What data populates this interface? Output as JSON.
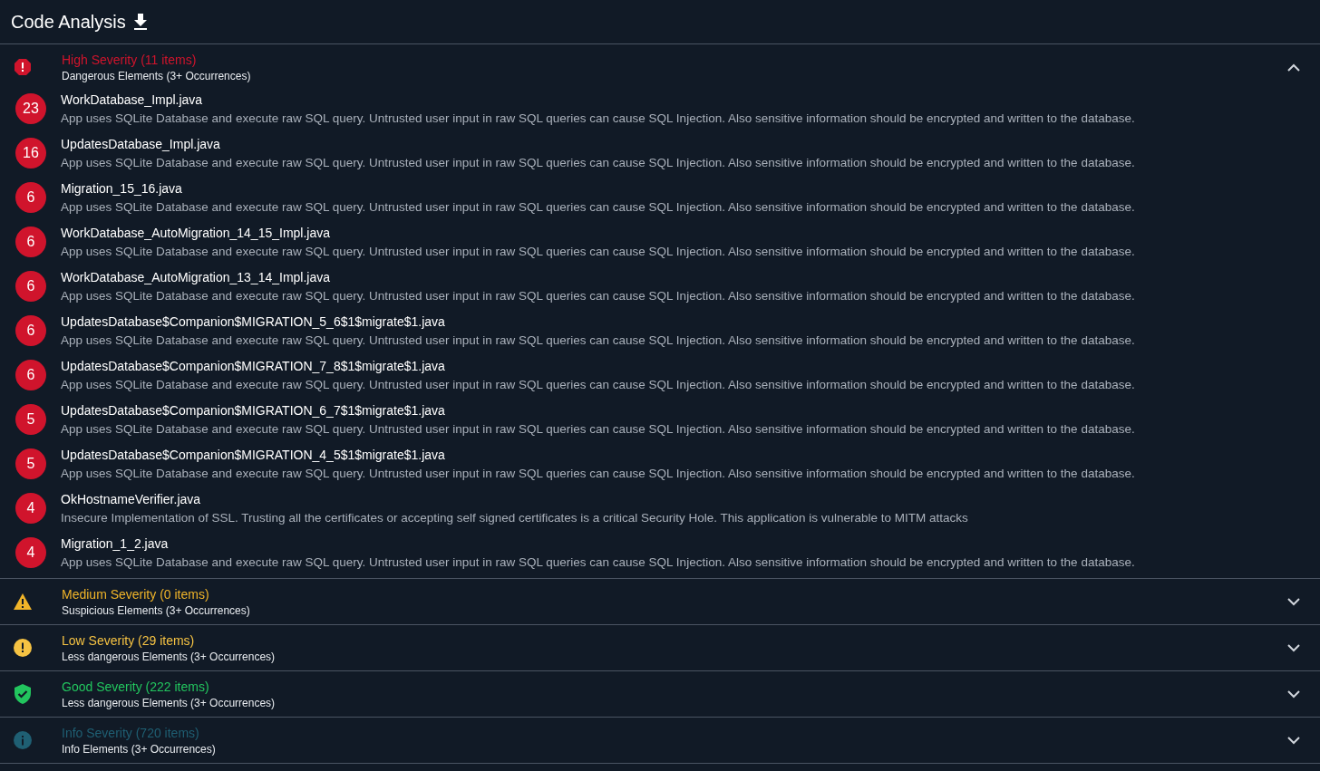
{
  "title": "Code Analysis",
  "sections": [
    {
      "kind": "error",
      "color": "#d0142c",
      "title": "High Severity (11 items)",
      "subtitle": "Dangerous Elements (3+ Occurrences)",
      "expanded": true,
      "items": [
        {
          "count": "23",
          "file": "WorkDatabase_Impl.java",
          "description": "App uses SQLite Database and execute raw SQL query. Untrusted user input in raw SQL queries can cause SQL Injection. Also sensitive information should be encrypted and written to the database."
        },
        {
          "count": "16",
          "file": "UpdatesDatabase_Impl.java",
          "description": "App uses SQLite Database and execute raw SQL query. Untrusted user input in raw SQL queries can cause SQL Injection. Also sensitive information should be encrypted and written to the database."
        },
        {
          "count": "6",
          "file": "Migration_15_16.java",
          "description": "App uses SQLite Database and execute raw SQL query. Untrusted user input in raw SQL queries can cause SQL Injection. Also sensitive information should be encrypted and written to the database."
        },
        {
          "count": "6",
          "file": "WorkDatabase_AutoMigration_14_15_Impl.java",
          "description": "App uses SQLite Database and execute raw SQL query. Untrusted user input in raw SQL queries can cause SQL Injection. Also sensitive information should be encrypted and written to the database."
        },
        {
          "count": "6",
          "file": "WorkDatabase_AutoMigration_13_14_Impl.java",
          "description": "App uses SQLite Database and execute raw SQL query. Untrusted user input in raw SQL queries can cause SQL Injection. Also sensitive information should be encrypted and written to the database."
        },
        {
          "count": "6",
          "file": "UpdatesDatabase$Companion$MIGRATION_5_6$1$migrate$1.java",
          "description": "App uses SQLite Database and execute raw SQL query. Untrusted user input in raw SQL queries can cause SQL Injection. Also sensitive information should be encrypted and written to the database."
        },
        {
          "count": "6",
          "file": "UpdatesDatabase$Companion$MIGRATION_7_8$1$migrate$1.java",
          "description": "App uses SQLite Database and execute raw SQL query. Untrusted user input in raw SQL queries can cause SQL Injection. Also sensitive information should be encrypted and written to the database."
        },
        {
          "count": "5",
          "file": "UpdatesDatabase$Companion$MIGRATION_6_7$1$migrate$1.java",
          "description": "App uses SQLite Database and execute raw SQL query. Untrusted user input in raw SQL queries can cause SQL Injection. Also sensitive information should be encrypted and written to the database."
        },
        {
          "count": "5",
          "file": "UpdatesDatabase$Companion$MIGRATION_4_5$1$migrate$1.java",
          "description": "App uses SQLite Database and execute raw SQL query. Untrusted user input in raw SQL queries can cause SQL Injection. Also sensitive information should be encrypted and written to the database."
        },
        {
          "count": "4",
          "file": "OkHostnameVerifier.java",
          "description": "Insecure Implementation of SSL. Trusting all the certificates or accepting self signed certificates is a critical Security Hole. This application is vulnerable to MITM attacks"
        },
        {
          "count": "4",
          "file": "Migration_1_2.java",
          "description": "App uses SQLite Database and execute raw SQL query. Untrusted user input in raw SQL queries can cause SQL Injection. Also sensitive information should be encrypted and written to the database."
        }
      ]
    },
    {
      "kind": "warning",
      "color": "#f0b429",
      "title": "Medium Severity (0 items)",
      "subtitle": "Suspicious Elements (3+ Occurrences)",
      "expanded": false
    },
    {
      "kind": "notice",
      "color": "#f6c343",
      "title": "Low Severity (29 items)",
      "subtitle": "Less dangerous Elements (3+ Occurrences)",
      "expanded": false
    },
    {
      "kind": "good",
      "color": "#22c55e",
      "title": "Good Severity (222 items)",
      "subtitle": "Less dangerous Elements (3+ Occurrences)",
      "expanded": false
    },
    {
      "kind": "info",
      "color": "#1f5f73",
      "title": "Info Severity (720 items)",
      "subtitle": "Info Elements (3+ Occurrences)",
      "expanded": false
    }
  ]
}
